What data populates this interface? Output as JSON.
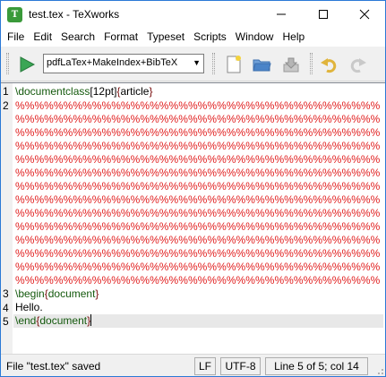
{
  "window": {
    "title": "test.tex - TeXworks",
    "app_icon_letter": "T"
  },
  "title_buttons": {
    "minimize": "—",
    "maximize": "☐",
    "close": "✕"
  },
  "menu": [
    "File",
    "Edit",
    "Search",
    "Format",
    "Typeset",
    "Scripts",
    "Window",
    "Help"
  ],
  "toolbar": {
    "typeset_engine": "pdfLaTex+MakeIndex+BibTeX",
    "buttons": [
      "typeset-play-icon",
      "new-document-icon",
      "open-folder-icon",
      "save-icon",
      "undo-icon",
      "redo-icon"
    ],
    "colors": {
      "play": "#3aa655",
      "folder": "#4b84c8"
    }
  },
  "editor": {
    "line_numbers": [
      "1",
      "2",
      "3",
      "4",
      "5"
    ],
    "line1": {
      "cmd": "\\documentclass",
      "bracket_open": "[",
      "option": "12pt",
      "bracket_close": "]",
      "brace_open": "{",
      "arg": "article",
      "brace_close": "}"
    },
    "line2_rows": [
      "%%%%%%%%%%%%%%%%%%%%%%%%%%%%%%%%%%%%%%",
      "%%%%%%%%%%%%%%%%%%%%%%%%%%%%%%%%%%%%%%",
      "%%%%%%%%%%%%%%%%%%%%%%%%%%%%%%%%%%%%%%",
      "%%%%%%%%%%%%%%%%%%%%%%%%%%%%%%%%%%%%%%",
      "%%%%%%%%%%%%%%%%%%%%%%%%%%%%%%%%%%%%%%",
      "%%%%%%%%%%%%%%%%%%%%%%%%%%%%%%%%%%%%%%",
      "%%%%%%%%%%%%%%%%%%%%%%%%%%%%%%%%%%%%%%",
      "%%%%%%%%%%%%%%%%%%%%%%%%%%%%%%%%%%%%%%",
      "%%%%%%%%%%%%%%%%%%%%%%%%%%%%%%%%%%%%%%",
      "%%%%%%%%%%%%%%%%%%%%%%%%%%%%%%%%%%%%%%",
      "%%%%%%%%%%%%%%%%%%%%%%%%%%%%%%%%%%%%%%",
      "%%%%%%%%%%%%%%%%%%%%%%%%%%%%%%%%%%%%%%",
      "%%%%%%%%%%%%%%%%%%%%%%%%%%%%%%%%%%%%%%",
      "%%%%%%%%%%%%%%%%%%%%%%%%%%%%%%%%%%%%%%"
    ],
    "line3": {
      "cmd": "\\begin",
      "brace_open": "{",
      "arg": "document",
      "brace_close": "}"
    },
    "line4": "Hello.",
    "line5": {
      "cmd": "\\end",
      "brace_open": "{",
      "arg": "document",
      "brace_close": "}"
    },
    "colors": {
      "command": "#14590d",
      "brace": "#7a0f0f",
      "comment": "#e01b1b"
    }
  },
  "status": {
    "message": "File \"test.tex\" saved",
    "line_ending": "LF",
    "encoding": "UTF-8",
    "position": "Line 5 of 5; col 14"
  }
}
